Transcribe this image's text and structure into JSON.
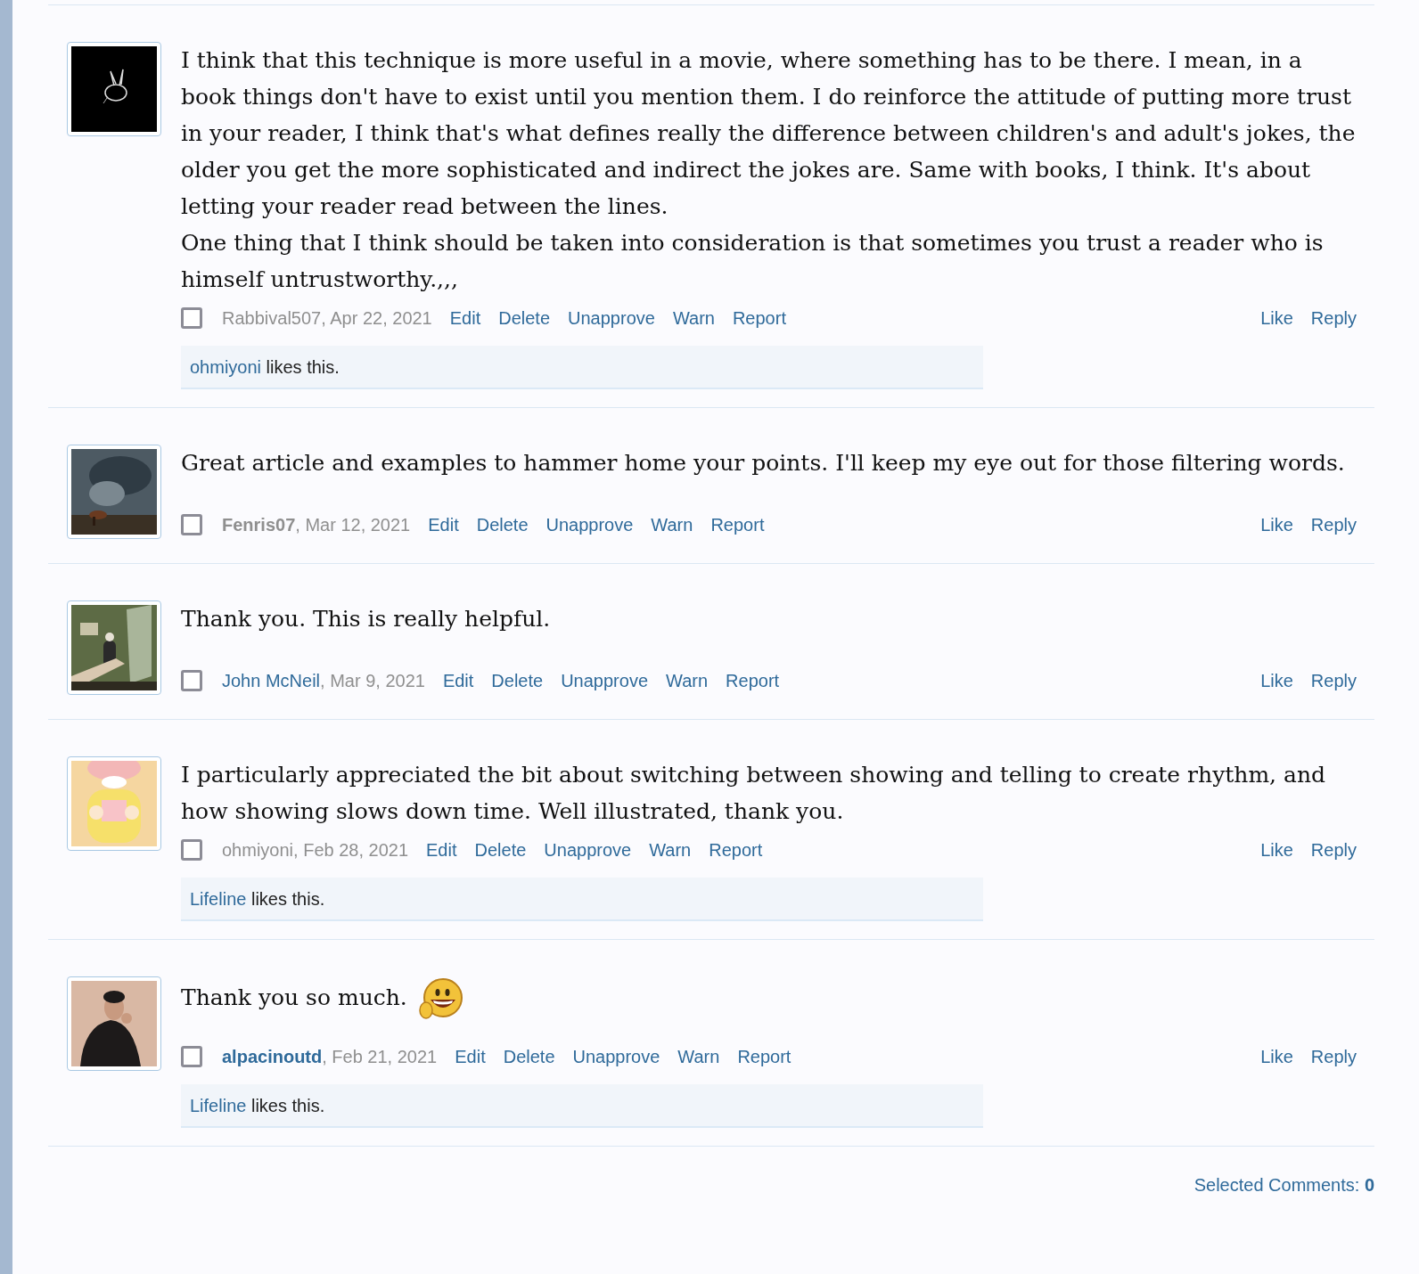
{
  "comments": [
    {
      "avatar": {
        "kind": "picture"
      },
      "paragraphs": [
        "I think that this technique is more useful in a movie, where something has to be there. I mean, in a book things don't have to exist until you mention them. I do reinforce the attitude of putting more trust in your reader, I think that's what defines really the difference between children's and adult's jokes, the older you get the more sophisticated and indirect the jokes are. Same with books, I think. It's about letting your reader read between the lines.",
        "One thing that I think should be taken into consideration is that sometimes you trust a reader who is himself untrustworthy.,,,"
      ],
      "smiley": false,
      "selected": false,
      "author": "Rabbival507",
      "author_bold": false,
      "author_link": false,
      "date": ", Apr 22, 2021",
      "actions": [
        "Edit",
        "Delete",
        "Unapprove",
        "Warn",
        "Report"
      ],
      "right_actions": [
        "Like",
        "Reply"
      ],
      "likes": {
        "user": "ohmiyoni",
        "text": " likes this."
      }
    },
    {
      "avatar": {
        "kind": "picture"
      },
      "paragraphs": [
        "Great article and examples to hammer home your points. I'll keep my eye out for those filtering words."
      ],
      "smiley": false,
      "selected": false,
      "author": "Fenris07",
      "author_bold": true,
      "author_link": false,
      "date": ", Mar 12, 2021",
      "actions": [
        "Edit",
        "Delete",
        "Unapprove",
        "Warn",
        "Report"
      ],
      "right_actions": [
        "Like",
        "Reply"
      ]
    },
    {
      "avatar": {
        "kind": "picture"
      },
      "paragraphs": [
        "Thank you. This is really helpful."
      ],
      "smiley": false,
      "selected": false,
      "author": "John McNeil",
      "author_bold": false,
      "author_link": true,
      "date": ", Mar 9, 2021",
      "actions": [
        "Edit",
        "Delete",
        "Unapprove",
        "Warn",
        "Report"
      ],
      "right_actions": [
        "Like",
        "Reply"
      ]
    },
    {
      "avatar": {
        "kind": "picture"
      },
      "paragraphs": [
        "I particularly appreciated the bit about switching between showing and telling to create rhythm, and how showing slows down time. Well illustrated, thank you."
      ],
      "smiley": false,
      "selected": false,
      "author": "ohmiyoni",
      "author_bold": false,
      "author_link": false,
      "date": ", Feb 28, 2021",
      "actions": [
        "Edit",
        "Delete",
        "Unapprove",
        "Warn",
        "Report"
      ],
      "right_actions": [
        "Like",
        "Reply"
      ],
      "likes": {
        "user": "Lifeline",
        "text": " likes this."
      }
    },
    {
      "avatar": {
        "kind": "picture"
      },
      "paragraphs": [
        "Thank you so much."
      ],
      "smiley": true,
      "selected": false,
      "author": "alpacinoutd",
      "author_bold": true,
      "author_link": true,
      "date": ", Feb 21, 2021",
      "actions": [
        "Edit",
        "Delete",
        "Unapprove",
        "Warn",
        "Report"
      ],
      "right_actions": [
        "Like",
        "Reply"
      ],
      "likes": {
        "user": "Lifeline",
        "text": " likes this."
      }
    }
  ],
  "footer": {
    "label": "Selected Comments: ",
    "count": "0"
  }
}
